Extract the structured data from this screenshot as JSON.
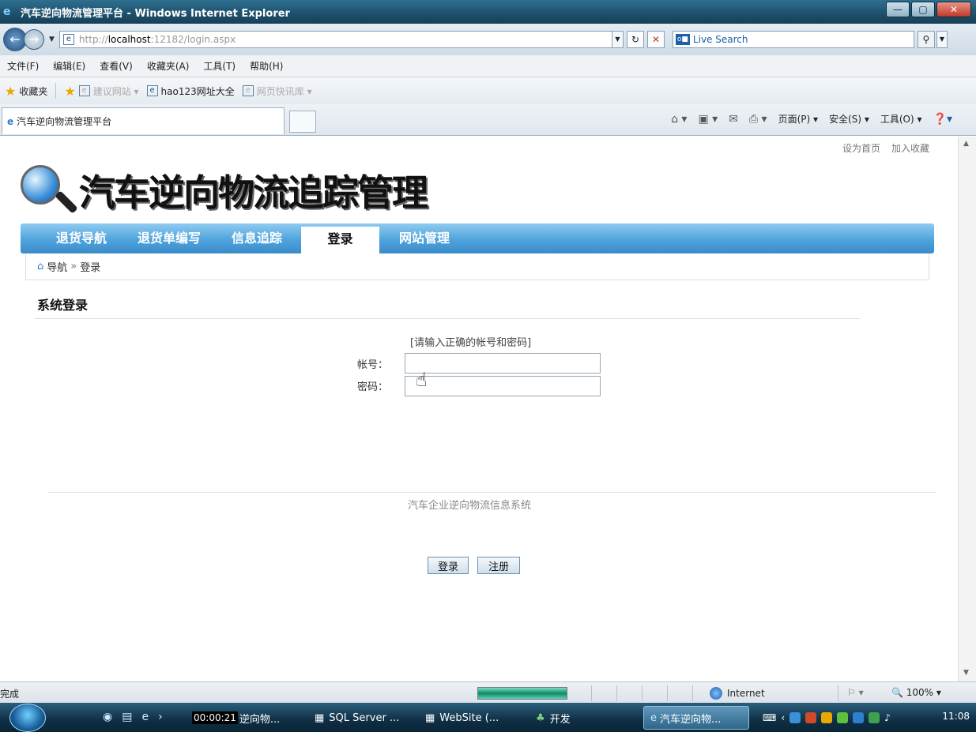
{
  "window": {
    "title": "汽车逆向物流管理平台 - Windows Internet Explorer",
    "minimize": "—",
    "maximize": "▢",
    "close": "✕"
  },
  "address": {
    "proto": "http://",
    "host": "localhost",
    "path": ":12182/login.aspx",
    "search_placeholder": "Live Search"
  },
  "menu": [
    "文件(F)",
    "编辑(E)",
    "查看(V)",
    "收藏夹(A)",
    "工具(T)",
    "帮助(H)"
  ],
  "favorites": {
    "label": "收藏夹",
    "items": [
      {
        "label": "建议网站 ▾"
      },
      {
        "label": "hao123网址大全"
      },
      {
        "label": "网页快讯库 ▾"
      }
    ]
  },
  "tab": {
    "title": "汽车逆向物流管理平台"
  },
  "commandbar": {
    "page": "页面(P) ▾",
    "safety": "安全(S) ▾",
    "tools": "工具(O) ▾"
  },
  "site": {
    "set_home": "设为首页",
    "add_favorite": "加入收藏",
    "logo_text": "汽车逆向物流追踪管理",
    "nav": [
      {
        "label": "退货导航"
      },
      {
        "label": "退货单编写"
      },
      {
        "label": "信息追踪"
      },
      {
        "label": "登录"
      },
      {
        "label": "网站管理"
      }
    ],
    "breadcrumb": {
      "root": "导航",
      "sep": "»",
      "current": "登录"
    }
  },
  "login": {
    "section_title": "系统登录",
    "hint": "[请输入正确的帐号和密码]",
    "account_label": "帐号：",
    "password_label": "密码：",
    "account_value": "",
    "password_value": "",
    "login_button": "登录",
    "register_button": "注册"
  },
  "footer": {
    "text": "汽车企业逆向物流信息系统"
  },
  "status": {
    "text": "完成",
    "progress": 1.0,
    "zone": "Internet",
    "zoom": "🔍 100% ▾"
  },
  "taskbar": {
    "timer": "00:00:21",
    "tasks": [
      {
        "label": "逆向物..."
      },
      {
        "label": "SQL Server ..."
      },
      {
        "label": "WebSite (..."
      },
      {
        "label": "开发"
      },
      {
        "label": "汽车逆向物..."
      }
    ],
    "clock": "11:08"
  },
  "colors": {
    "nav_bar": "#4fa3dc",
    "title_bar": "#1d4f6b"
  }
}
